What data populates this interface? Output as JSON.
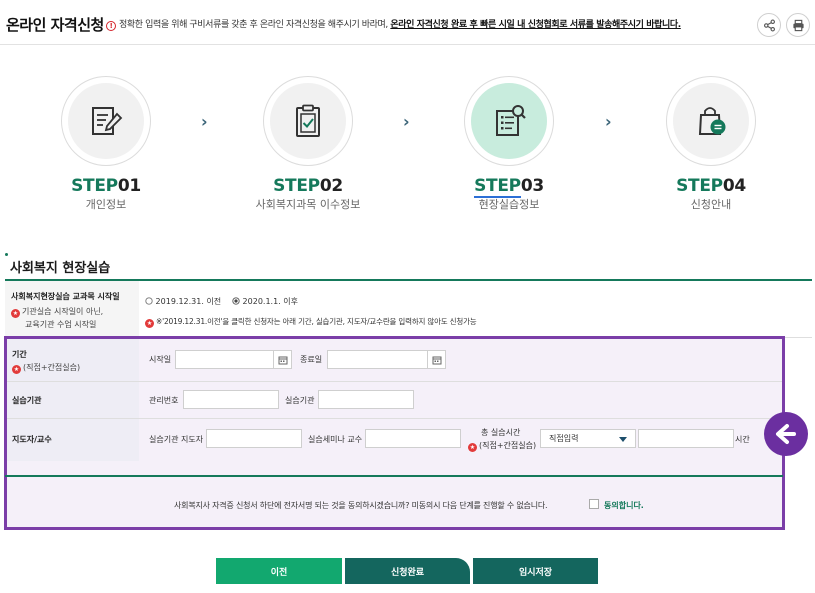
{
  "header": {
    "title": "온라인 자격신청",
    "notice_normal": "정확한 입력을 위해 구비서류를 갖춘 후 온라인 자격신청을 해주시기 바라며, ",
    "notice_strong": "온라인 자격신청 완료 후 빠른 시일 내 신청협회로 서류를 발송해주시기 바랍니다.",
    "warn_glyph": "!"
  },
  "steps": [
    {
      "prefix": "STEP",
      "num": "01",
      "sub": "개인정보",
      "icon": "edit-document-icon",
      "active": false
    },
    {
      "prefix": "STEP",
      "num": "02",
      "sub": "사회복지과목 이수정보",
      "icon": "clipboard-check-icon",
      "active": false
    },
    {
      "prefix": "STEP",
      "num": "03",
      "sub": "현장실습정보",
      "icon": "search-list-icon",
      "active": true
    },
    {
      "prefix": "STEP",
      "num": "04",
      "sub": "신청안내",
      "icon": "shopping-bag-message-icon",
      "active": false
    }
  ],
  "section": {
    "title": "사회복지 현장실습"
  },
  "curriculum": {
    "label": "사회복지현장실습 교과목 시작일",
    "sub1": "기관실습 시작일이 아닌,",
    "sub2": "교육기관 수업 시작일",
    "option1": "2019.12.31. 이전",
    "option2": "2020.1.1. 이후",
    "selected": "2020.1.1. 이후",
    "note": "※'2019.12.31.이전'을 클릭한 신청자는 아래 기간, 실습기관, 지도자/교수란을 입력하지 않아도 신청가능"
  },
  "period": {
    "label": "기간",
    "sub": "(직접+간접실습)",
    "start_label": "시작일",
    "start_value": "",
    "end_label": "종료일",
    "end_value": ""
  },
  "institution": {
    "label": "실습기관",
    "mgmt_label": "관리번호",
    "mgmt_value": "",
    "inst_label": "실습기관",
    "inst_value": ""
  },
  "supervisor": {
    "label": "지도자/교수",
    "inst_sup_label": "실습기관 지도자",
    "inst_sup_value": "",
    "seminar_label": "실습세미나 교수",
    "seminar_value": "",
    "total_label": "총 실습시간",
    "total_sub": "(직접+간접실습)",
    "select_value": "직접입력",
    "hours_value": "",
    "hours_unit": "시간"
  },
  "agreement": {
    "text": "사회복지사 자격증 신청서 하단에 전자서명 되는 것을 동의하시겠습니까? 미동의시 다음 단계를 진행할 수 없습니다.",
    "checkbox_label": "동의합니다.",
    "checked": false
  },
  "buttons": {
    "prev": "이전",
    "complete": "신청완료",
    "temp_save": "임시저장"
  },
  "colors": {
    "brand_green": "#15795b",
    "button_green": "#12a86f",
    "button_teal": "#14665e",
    "highlight_purple": "#7b3ea8",
    "required_red": "#e23b3b"
  }
}
